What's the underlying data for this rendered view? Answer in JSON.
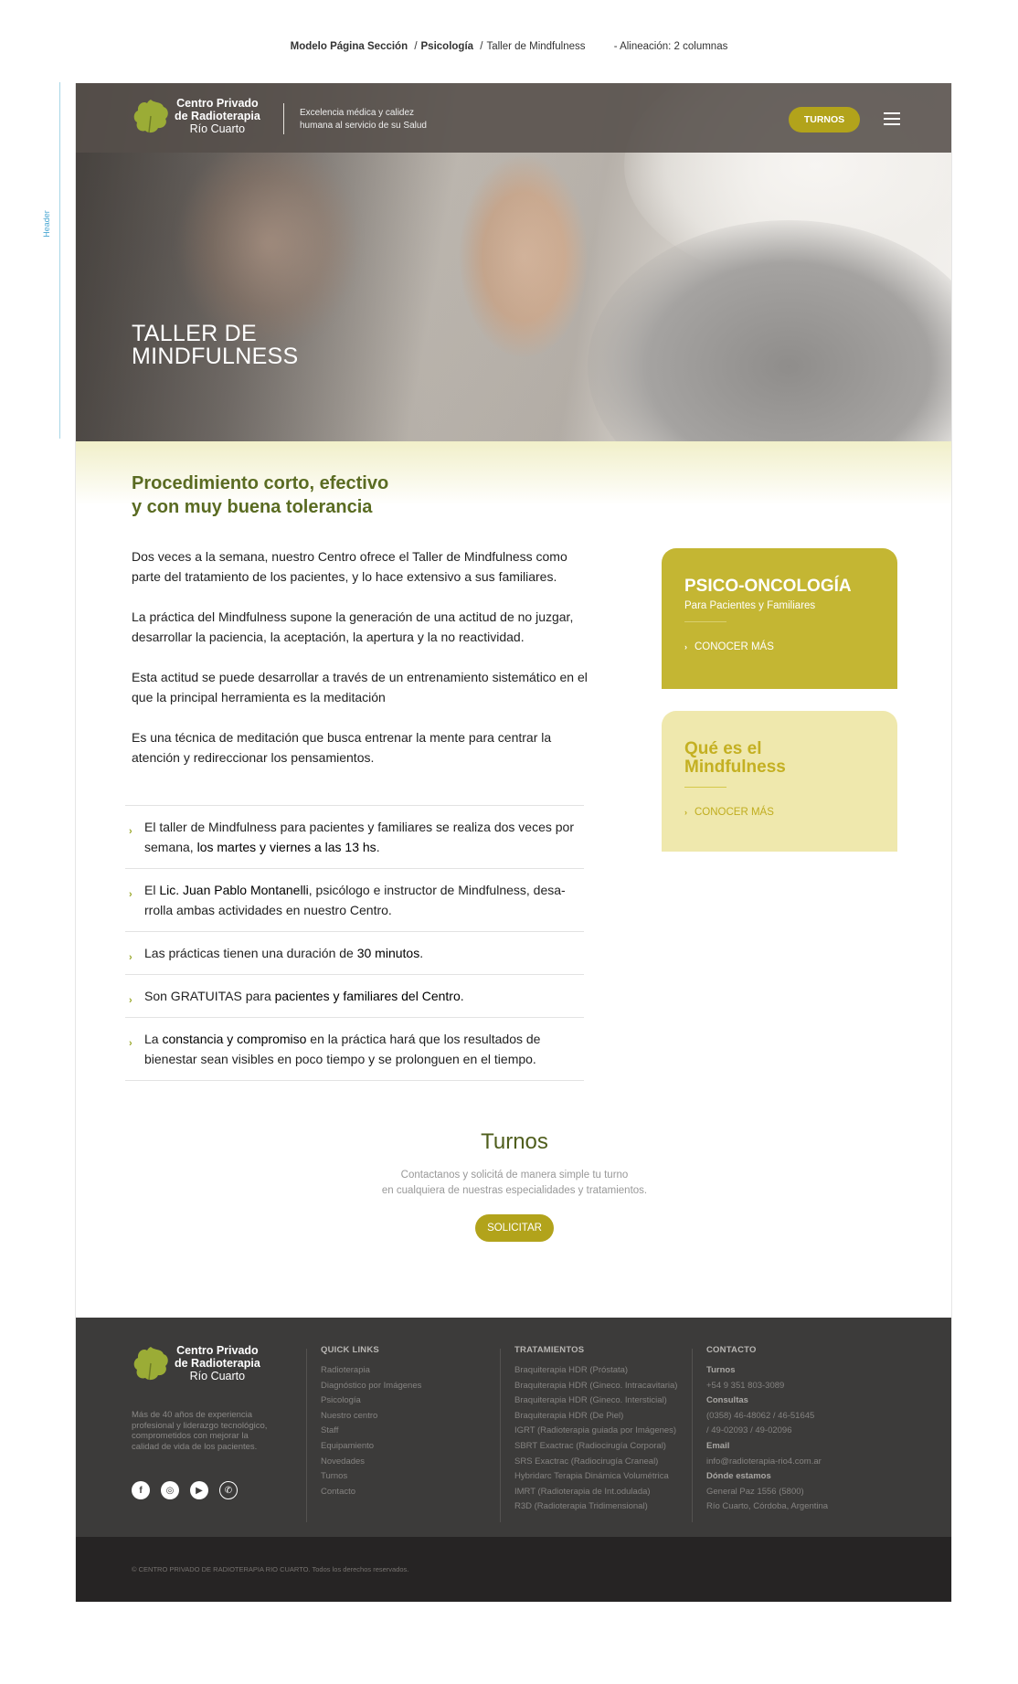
{
  "breadcrumb": {
    "page_model": "Modelo Página Sección",
    "section": "Psicología",
    "current": "Taller de Mindfulness",
    "alignment": "- Alineación: 2 columnas"
  },
  "side_label": "Header",
  "header": {
    "logo_line1": "Centro Privado",
    "logo_line2": "de Radioterapia",
    "logo_line3": "Río Cuarto",
    "tagline_line1": "Excelencia médica y calidez",
    "tagline_line2": "humana al servicio de su Salud",
    "turnos_label": "TURNOS"
  },
  "hero": {
    "title_line1": "TALLER DE",
    "title_line2": "MINDFULNESS"
  },
  "intro": {
    "lead_line1": "Procedimiento corto, efectivo",
    "lead_line2": "y con muy buena tolerancia",
    "p1": "Dos veces a la semana, nuestro Centro ofrece el Taller de Mindfulness como parte del tratamiento de los pacientes, y lo hace extensivo a sus familiares.",
    "p2": "La práctica del Mindfulness supone la generación de una actitud de no juzgar, desarrollar la paciencia, la aceptación, la apertura y la no reactividad.",
    "p3": "Esta actitud se puede desarrollar a través de un entrenamiento sistemático en el que la principal herramienta es la meditación",
    "p4": "Es una técnica de meditación que busca entrenar la mente para centrar la atención y redireccionar los pensamientos."
  },
  "bullets": [
    {
      "a": "El taller de Mindfulness para pacientes y familiares se realiza dos veces por semana, ",
      "b": "los martes y viernes a las 13 hs",
      "c": "."
    },
    {
      "a": "El ",
      "b": "Lic. Juan Pablo Montanelli",
      "c": ", psicólogo e instructor de Mindfulness, desa-rrolla ambas actividades en nuestro Centro."
    },
    {
      "a": "Las prácticas tienen una duración de ",
      "b": "30 minutos",
      "c": "."
    },
    {
      "a": "Son GRATUITAS para ",
      "b": "pacientes y familiares del Centro",
      "c": "."
    },
    {
      "a": "La ",
      "b": "constancia y compromiso",
      "c": " en la práctica hará que los resultados de bienestar sean visibles en poco tiempo y se prolonguen en el tiempo."
    }
  ],
  "cards": {
    "psico": {
      "title": "PSICO-ONCOLOGÍA",
      "subtitle": "Para Pacientes y Familiares",
      "link": "CONOCER MÁS"
    },
    "mind": {
      "title_line1": "Qué es el",
      "title_line2": "Mindfulness",
      "link": "CONOCER MÁS"
    }
  },
  "turnos": {
    "title": "Turnos",
    "desc_line1": "Contactanos y solicitá de manera simple tu turno",
    "desc_line2": "en cualquiera de nuestras especialidades y tratamientos.",
    "button": "SOLICITAR"
  },
  "footer": {
    "about_line1": "Más de 40 años de experiencia",
    "about_line2": "profesional y liderazgo tecnológico,",
    "about_line3": "comprometidos con mejorar la",
    "about_line4": "calidad de vida de los pacientes.",
    "quick_links_title": "QUICK LINKS",
    "quick_links": [
      "Radioterapia",
      "Diagnóstico por Imágenes",
      "Psicología",
      "Nuestro centro",
      "Staff",
      "Equipamiento",
      "Novedades",
      "Turnos",
      "Contacto"
    ],
    "treatments_title": "TRATAMIENTOS",
    "treatments": [
      "Braquiterapia HDR (Próstata)",
      "Braquiterapia HDR (Gineco. Intracavitaria)",
      "Braquiterapia HDR (Gineco. Intersticial)",
      "Braquiterapia HDR (De Piel)",
      "IGRT (Radioterapia guiada por Imágenes)",
      "SBRT Exactrac (Radiocirugía Corporal)",
      "SRS Exactrac (Radiocirugía Craneal)",
      "Hybridarc Terapia Dinámica Volumétrica",
      "IMRT (Radioterapia de Int.odulada)",
      "R3D (Radioterapia Tridimensional)"
    ],
    "contact_title": "CONTACTO",
    "contact": [
      {
        "text": "Turnos",
        "bold": true
      },
      {
        "text": "+54 9 351 803-3089",
        "bold": false
      },
      {
        "text": "Consultas",
        "bold": true
      },
      {
        "text": "(0358) 46-48062 / 46-51645",
        "bold": false
      },
      {
        "text": "/ 49-02093 / 49-02096",
        "bold": false
      },
      {
        "text": "Email",
        "bold": true
      },
      {
        "text": "info@radioterapia-rio4.com.ar",
        "bold": false
      },
      {
        "text": "Dónde estamos",
        "bold": true
      },
      {
        "text": "General Paz 1556 (5800)",
        "bold": false
      },
      {
        "text": "Río Cuarto, Córdoba, Argentina",
        "bold": false
      }
    ],
    "social": {
      "facebook": "f",
      "instagram": "◎",
      "youtube": "▶",
      "whatsapp": "✆"
    },
    "copyright": "© CENTRO PRIVADO DE RADIOTERAPIA RIO CUARTO. Todos los derechos reservados."
  },
  "colors": {
    "accent": "#b2a31b",
    "card_dark": "#c4b633",
    "card_light": "#efe8ad",
    "heading_green": "#5a6b22",
    "footer_bg": "#3c3b3a",
    "bottom_bg": "#262424"
  }
}
